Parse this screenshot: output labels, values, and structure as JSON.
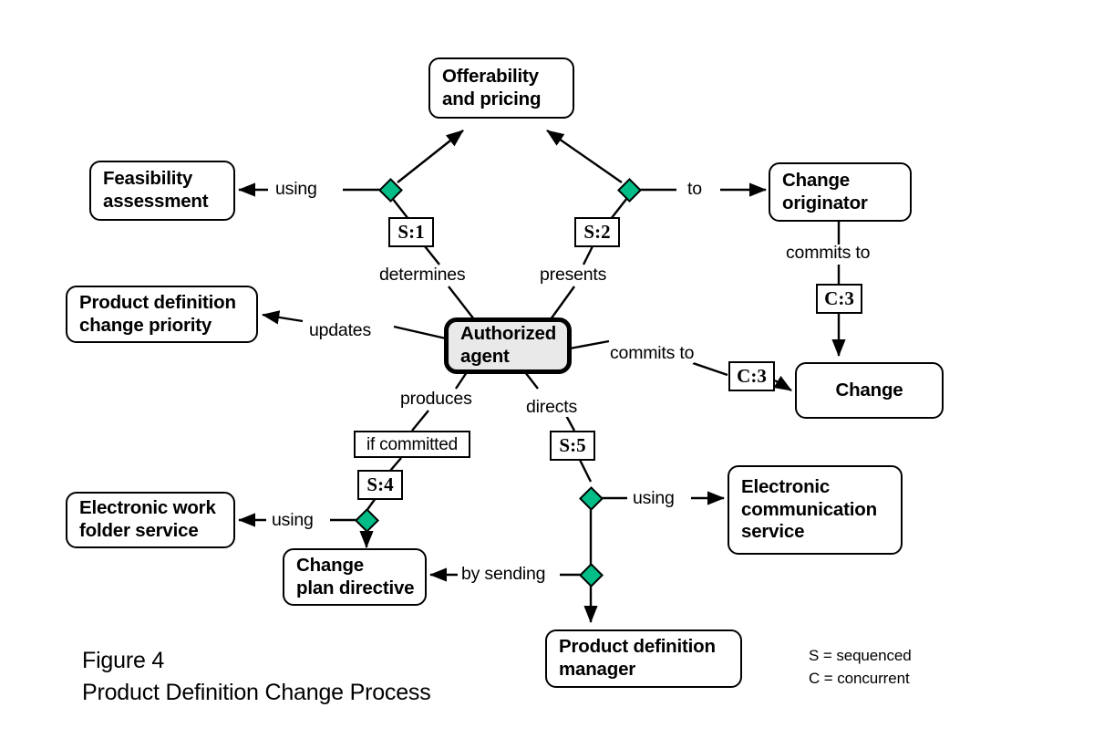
{
  "figure": {
    "number_line": "Figure 4",
    "title_line": "Product Definition Change Process"
  },
  "legend": {
    "line1": "S = sequenced",
    "line2": "C = concurrent"
  },
  "nodes": [
    {
      "id": "offerability",
      "lines": [
        "Offerability",
        "and pricing"
      ],
      "emphasis": false
    },
    {
      "id": "feasibility",
      "lines": [
        "Feasibility",
        "assessment"
      ],
      "emphasis": false
    },
    {
      "id": "change-originator",
      "lines": [
        "Change",
        "originator"
      ],
      "emphasis": false
    },
    {
      "id": "priority",
      "lines": [
        "Product definition",
        "change priority"
      ],
      "emphasis": false
    },
    {
      "id": "authorized-agent",
      "lines": [
        "Authorized",
        "agent"
      ],
      "emphasis": true
    },
    {
      "id": "change",
      "lines": [
        "Change"
      ],
      "emphasis": false
    },
    {
      "id": "ework-folder",
      "lines": [
        "Electronic work",
        "folder service"
      ],
      "emphasis": false
    },
    {
      "id": "change-plan",
      "lines": [
        "Change",
        "plan directive"
      ],
      "emphasis": false
    },
    {
      "id": "ecomm-service",
      "lines": [
        "Electronic",
        "communication",
        "service"
      ],
      "emphasis": false
    },
    {
      "id": "pd-manager",
      "lines": [
        "Product definition",
        "manager"
      ],
      "emphasis": false
    }
  ],
  "tagboxes": [
    {
      "id": "s1",
      "label": "S:1"
    },
    {
      "id": "s2",
      "label": "S:2"
    },
    {
      "id": "c3-originator",
      "label": "C:3"
    },
    {
      "id": "c3-agent",
      "label": "C:3"
    },
    {
      "id": "if-committed",
      "label": "if committed"
    },
    {
      "id": "s4",
      "label": "S:4"
    },
    {
      "id": "s5",
      "label": "S:5"
    }
  ],
  "relations": [
    {
      "id": "using-feasibility",
      "label": "using"
    },
    {
      "id": "to-originator",
      "label": "to"
    },
    {
      "id": "determines",
      "label": "determines"
    },
    {
      "id": "presents",
      "label": "presents"
    },
    {
      "id": "commits-to-change",
      "label": "commits to"
    },
    {
      "id": "updates",
      "label": "updates"
    },
    {
      "id": "commits-to-agent",
      "label": "commits to"
    },
    {
      "id": "produces",
      "label": "produces"
    },
    {
      "id": "directs",
      "label": "directs"
    },
    {
      "id": "using-ework",
      "label": "using"
    },
    {
      "id": "using-ecomm",
      "label": "using"
    },
    {
      "id": "by-sending",
      "label": "by sending"
    }
  ],
  "colors": {
    "junction_fill": "#00bd87",
    "stroke": "#000000",
    "emphasis_fill": "#e9e9e9",
    "background": "#ffffff"
  }
}
